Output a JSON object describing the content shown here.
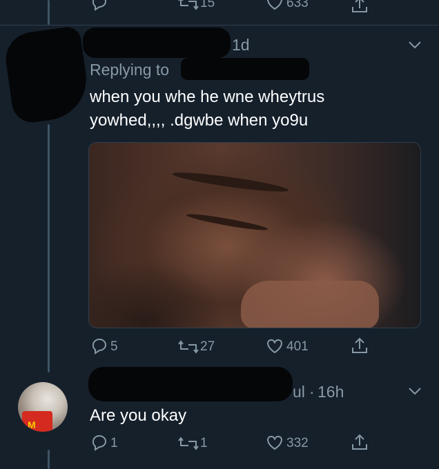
{
  "top_actions": {
    "retweets": "15",
    "likes": "633"
  },
  "tweet1": {
    "time": "1d",
    "replying_to_label": "Replying to",
    "text_line1": "when you whe he wne wheytrus",
    "text_line2": "yowhed,,,, .dgwbe when yo9u",
    "replies": "5",
    "retweets": "27",
    "likes": "401"
  },
  "tweet2": {
    "handle_tail": "ul",
    "time": "16h",
    "text": "Are you okay",
    "replies": "1",
    "retweets": "1",
    "likes": "332"
  },
  "colors": {
    "background": "#15202b",
    "muted": "#8899a6",
    "thread_line": "#3d5466"
  },
  "icons": [
    "reply-icon",
    "retweet-icon",
    "like-icon",
    "share-icon",
    "chevron-down-icon"
  ]
}
